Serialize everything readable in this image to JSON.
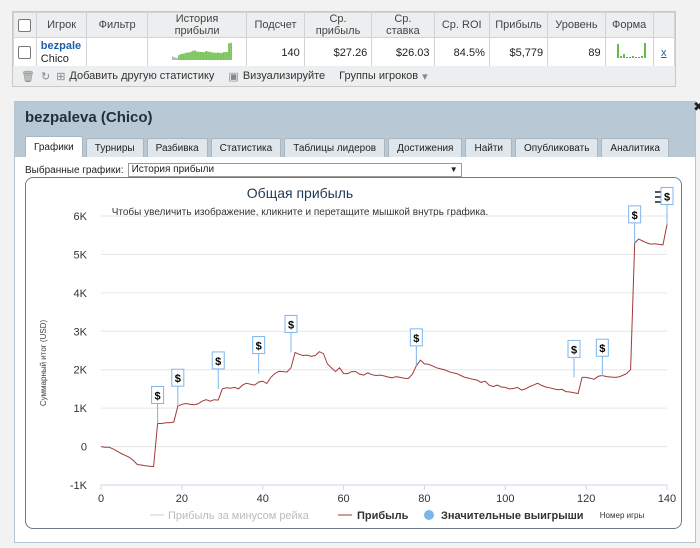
{
  "table": {
    "headers": [
      "Игрок",
      "Фильтр",
      "История прибыли",
      "Подсчет",
      "Ср. прибыль",
      "Ср. ставка",
      "Ср. ROI",
      "Прибыль",
      "Уровень",
      "Форма"
    ],
    "row": {
      "nick": "bezpaleva",
      "real_name": "Chico",
      "filter": "",
      "count": "140",
      "avg_profit": "$27.26",
      "avg_stake": "$26.03",
      "avg_roi": "84.5%",
      "profit": "$5,779",
      "level": "89",
      "remove": "x"
    }
  },
  "toolbar": {
    "add_stats": "Добавить другую статистику",
    "visualize": "Визуализируйте",
    "player_groups": "Группы игроков"
  },
  "window": {
    "title": "bezpaleva (Chico)",
    "tabs": [
      "Графики",
      "Турниры",
      "Разбивка",
      "Статистика",
      "Таблицы лидеров",
      "Достижения",
      "Найти",
      "Опубликовать",
      "Аналитика"
    ],
    "selector_label": "Выбранные графики:",
    "selector_value": "История прибыли"
  },
  "colors": {
    "profit_line": "#a23a3a",
    "significant_marker": "#7cb5ec",
    "sparkline": "#66bb44"
  },
  "chart_data": {
    "type": "line",
    "title": "Общая прибыль",
    "subtitle": "Чтобы увеличить изображение, кликните и перетащите мышкой внутрь графика.",
    "xlabel": "Номер игры",
    "ylabel": "Суммарный итог (USD)",
    "xlim": [
      0,
      140
    ],
    "ylim": [
      -1000,
      6000
    ],
    "xticks": [
      0,
      20,
      40,
      60,
      80,
      100,
      120,
      140
    ],
    "yticks": [
      -1000,
      0,
      1000,
      2000,
      3000,
      4000,
      5000,
      6000
    ],
    "ytick_labels": [
      "-1K",
      "0",
      "1K",
      "2K",
      "3K",
      "4K",
      "5K",
      "6K"
    ],
    "legend": [
      "Прибыль за минусом рейка",
      "Прибыль",
      "Значительные выигрыши"
    ],
    "legend_position": "bottom",
    "series": [
      {
        "name": "Прибыль",
        "x": [
          0,
          1,
          2,
          3,
          4,
          5,
          6,
          7,
          8,
          9,
          10,
          11,
          12,
          13,
          14,
          15,
          16,
          17,
          18,
          19,
          20,
          21,
          22,
          23,
          24,
          25,
          26,
          27,
          28,
          29,
          30,
          31,
          32,
          33,
          34,
          35,
          36,
          37,
          38,
          39,
          40,
          41,
          42,
          43,
          44,
          45,
          46,
          47,
          48,
          49,
          50,
          51,
          52,
          53,
          54,
          55,
          56,
          57,
          58,
          59,
          60,
          61,
          62,
          63,
          64,
          65,
          66,
          67,
          68,
          69,
          70,
          71,
          72,
          73,
          74,
          75,
          76,
          77,
          78,
          79,
          80,
          81,
          82,
          83,
          84,
          85,
          86,
          87,
          88,
          89,
          90,
          91,
          92,
          93,
          94,
          95,
          96,
          97,
          98,
          99,
          100,
          101,
          102,
          103,
          104,
          105,
          106,
          107,
          108,
          109,
          110,
          111,
          112,
          113,
          114,
          115,
          116,
          117,
          118,
          119,
          120,
          121,
          122,
          123,
          124,
          125,
          126,
          127,
          128,
          129,
          130,
          131,
          132,
          133,
          134,
          135,
          136,
          137,
          138,
          139,
          140
        ],
        "y": [
          0,
          -20,
          -20,
          -60,
          -120,
          -180,
          -230,
          -280,
          -360,
          -470,
          -480,
          -500,
          -510,
          -520,
          600,
          600,
          620,
          620,
          640,
          1050,
          1100,
          1120,
          1100,
          1090,
          1110,
          1180,
          1220,
          1180,
          1220,
          1210,
          1500,
          1530,
          1520,
          1540,
          1500,
          1600,
          1650,
          1620,
          1600,
          1680,
          1700,
          1640,
          1800,
          1900,
          1960,
          1950,
          1940,
          2050,
          2450,
          2400,
          2370,
          2380,
          2350,
          2370,
          2470,
          2420,
          2150,
          2050,
          1950,
          2050,
          1900,
          1900,
          1950,
          1950,
          1880,
          1860,
          1920,
          1870,
          1850,
          1860,
          1840,
          1810,
          1790,
          1820,
          1800,
          1780,
          1770,
          1880,
          2100,
          2250,
          2150,
          2140,
          2100,
          2050,
          2020,
          2000,
          1950,
          1920,
          1900,
          1850,
          1800,
          1780,
          1750,
          1730,
          1670,
          1700,
          1600,
          1560,
          1600,
          1550,
          1540,
          1500,
          1510,
          1540,
          1470,
          1500,
          1560,
          1600,
          1650,
          1590,
          1550,
          1530,
          1500,
          1480,
          1490,
          1430,
          1420,
          1400,
          1380,
          1800,
          1800,
          1780,
          1750,
          1830,
          1850,
          1820,
          1810,
          1800,
          1810,
          1850,
          1900,
          2000,
          5300,
          5400,
          5350,
          5300,
          5270,
          5280,
          5260,
          5250,
          5779
        ]
      },
      {
        "name": "Значительные выигрыши",
        "x": [
          14,
          19,
          29,
          39,
          47,
          78,
          117,
          124,
          132,
          140
        ],
        "y": [
          600,
          1050,
          1500,
          1900,
          2450,
          2100,
          1800,
          1830,
          5300,
          5779
        ]
      }
    ]
  }
}
